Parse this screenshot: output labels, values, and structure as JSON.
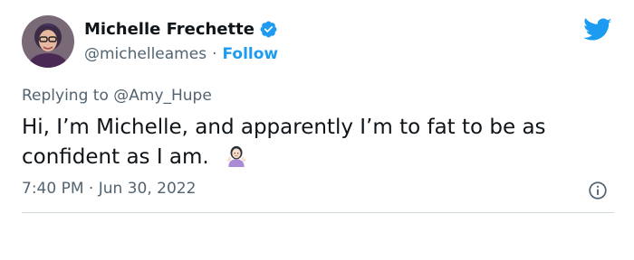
{
  "author": {
    "display_name": "Michelle Frechette",
    "handle": "@michelleames",
    "separator": "·",
    "follow_label": "Follow"
  },
  "reply": {
    "prefix": "Replying to",
    "target": "@Amy_Hupe"
  },
  "tweet": {
    "text": "Hi, I’m Michelle, and apparently I’m to fat to be as confident as I am."
  },
  "meta": {
    "time": "7:40 PM",
    "separator": "·",
    "date": "Jun 30, 2022"
  },
  "icons": {
    "verified": "verified-badge-icon",
    "twitter": "twitter-bird-icon",
    "emoji": "woman-shrugging-emoji",
    "info": "info-icon"
  },
  "colors": {
    "accent": "#1d9bf0",
    "text_primary": "#0f1419",
    "text_secondary": "#536471",
    "divider": "#cfd9de"
  }
}
